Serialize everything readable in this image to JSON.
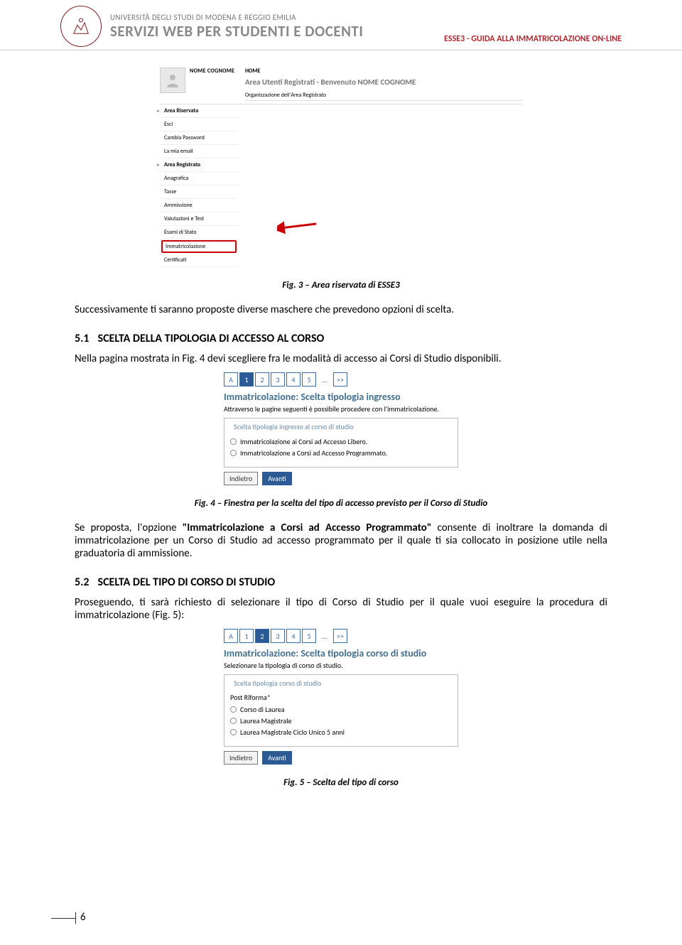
{
  "header": {
    "university": "UNIVERSITÀ DEGLI STUDI DI MODENA E REGGIO EMILIA",
    "service_title": "SERVIZI WEB PER STUDENTI E DOCENTI",
    "doc_title": "ESSE3 - GUIDA ALLA IMMATRICOLAZIONE ON-LINE"
  },
  "fig3": {
    "user_name": "NOME COGNOME",
    "home": "HOME",
    "welcome": "Area Utenti Registrati - Benvenuto NOME COGNOME",
    "org": "Organizzazione dell'Area Registrato",
    "menu_h1": "Area Riservata",
    "m1": "Esci",
    "m2": "Cambia Password",
    "m3": "La mia email",
    "menu_h2": "Area Registrato",
    "m4": "Anagrafica",
    "m5": "Tasse",
    "m6": "Ammissione",
    "m7": "Valutazioni e Test",
    "m8": "Esami di Stato",
    "m9": "Immatricolazione",
    "m10": "Certificati",
    "caption": "Fig. 3 – Area riservata di ESSE3"
  },
  "body": {
    "p1": "Successivamente ti saranno proposte diverse maschere che prevedono opzioni di scelta.",
    "sec51_num": "5.1",
    "sec51": "SCELTA DELLA TIPOLOGIA DI ACCESSO AL CORSO",
    "p2": "Nella pagina mostrata in Fig. 4 devi scegliere fra le modalità di accesso ai Corsi di Studio disponibili.",
    "p3a": "Se proposta, l'opzione ",
    "p3b": "\"Immatricolazione a Corsi ad Accesso Programmato\"",
    "p3c": " consente di inoltrare la domanda di immatricolazione per un Corso di Studio ad accesso programmato per il quale ti sia collocato in posizione utile nella graduatoria di ammissione.",
    "sec52_num": "5.2",
    "sec52": "SCELTA DEL TIPO DI CORSO DI STUDIO",
    "p4": "Proseguendo, ti sarà richiesto di selezionare il tipo di Corso di Studio per il quale vuoi eseguire la procedura di immatricolazione (Fig. 5):"
  },
  "wizard": {
    "a": "A",
    "s1": "1",
    "s2": "2",
    "s3": "3",
    "s4": "4",
    "s5": "5",
    "dots": "…",
    "next": ">>"
  },
  "fig4": {
    "title": "Immatricolazione: Scelta tipologia ingresso",
    "sub": "Attraverso le pagine seguenti è possibile procedere con l'immatricolazione.",
    "legend": "Scelta tipologia ingresso al corso di studio",
    "opt1": "Immatricolazione ai Corsi ad Accesso Libero.",
    "opt2": "Immatricolazione a Corsi ad Accesso Programmato.",
    "back": "Indietro",
    "fwd": "Avanti",
    "caption": "Fig. 4 – Finestra per la scelta del tipo di accesso previsto per il Corso di Studio"
  },
  "fig5": {
    "title": "Immatricolazione: Scelta tipologia corso di studio",
    "sub": "Selezionare la tipologia di corso di studio.",
    "legend": "Scelta tipologia corso di studio",
    "post": "Post Riforma*",
    "opt1": "Corso di Laurea",
    "opt2": "Laurea Magistrale",
    "opt3": "Laurea Magistrale Ciclo Unico 5 anni",
    "back": "Indietro",
    "fwd": "Avanti",
    "caption": "Fig. 5 – Scelta del tipo di corso"
  },
  "page_number": "6"
}
